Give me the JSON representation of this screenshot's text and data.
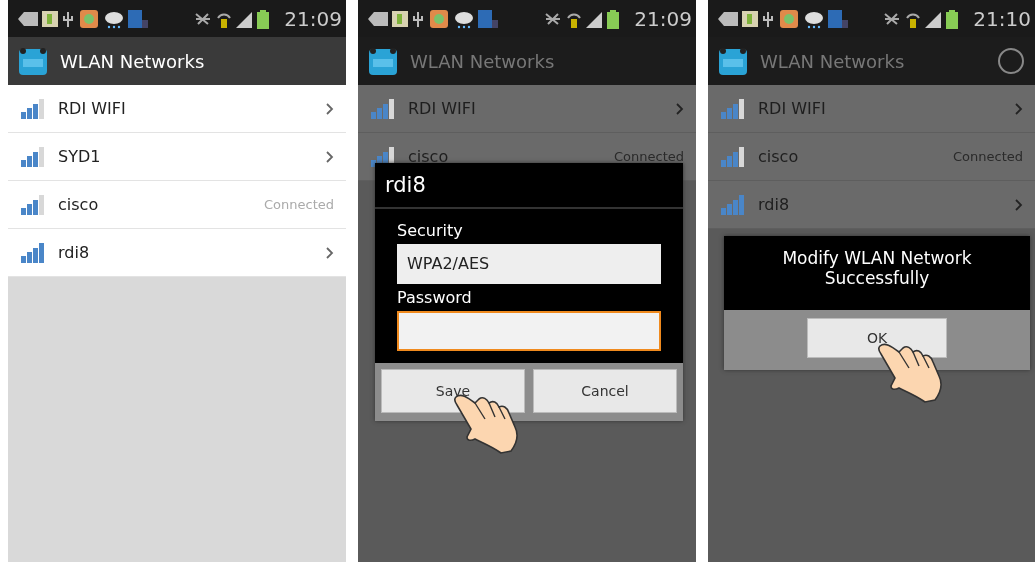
{
  "screens": [
    {
      "status_bar": {
        "time": "21:09"
      },
      "app_bar": {
        "title": "WLAN Networks",
        "busy": false
      },
      "dimmed": false,
      "networks": [
        {
          "name": "RDI WIFI",
          "full_signal": false
        },
        {
          "name": "SYD1",
          "full_signal": false
        },
        {
          "name": "cisco",
          "status": "Connected",
          "full_signal": false
        },
        {
          "name": "rdi8",
          "full_signal": true
        }
      ]
    },
    {
      "status_bar": {
        "time": "21:09"
      },
      "app_bar": {
        "title": "WLAN Networks",
        "busy": false
      },
      "dimmed": true,
      "networks": [
        {
          "name": "RDI WIFI",
          "full_signal": false
        },
        {
          "name": "cisco",
          "status": "Connected",
          "full_signal": false
        }
      ],
      "dialog": {
        "kind": "form",
        "title": "rdi8",
        "fields": [
          {
            "label": "Security",
            "value": "WPA2/AES",
            "focused": false
          },
          {
            "label": "Password",
            "focused": true
          }
        ],
        "buttons": [
          {
            "label": "Save",
            "pointer": true
          },
          {
            "label": "Cancel",
            "pointer": false
          }
        ]
      }
    },
    {
      "status_bar": {
        "time": "21:10"
      },
      "app_bar": {
        "title": "WLAN Networks",
        "busy": true
      },
      "dimmed": true,
      "networks": [
        {
          "name": "RDI WIFI",
          "full_signal": false
        },
        {
          "name": "cisco",
          "status": "Connected",
          "full_signal": false
        },
        {
          "name": "rdi8",
          "full_signal": true
        }
      ],
      "dialog": {
        "kind": "message",
        "message": "Modify WLAN Network Successfully",
        "buttons": [
          {
            "label": "OK",
            "pointer": true
          }
        ]
      }
    }
  ]
}
